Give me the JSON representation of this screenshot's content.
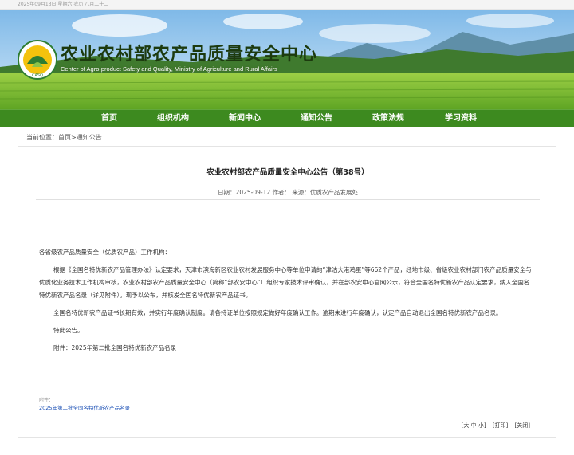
{
  "topbar": {
    "date_text": "2025年09月13日 星期六 农历 八月二十二"
  },
  "header": {
    "title": "农业农村部农产品质量安全中心",
    "subtitle": "Center of Agro-product Safety and Quality, Ministry of Agriculture and Rural Affairs",
    "colors": {
      "nav_green": "#3d8a1f",
      "field_green": "#7bbf2f",
      "sky_blue": "#8ec5ec"
    }
  },
  "nav": {
    "items": [
      "首页",
      "组织机构",
      "新闻中心",
      "通知公告",
      "政策法规",
      "学习资料"
    ]
  },
  "breadcrumb": {
    "prefix": "当前位置：",
    "home": "首页",
    "separator": ">",
    "section": "通知公告"
  },
  "article": {
    "title": "农业农村部农产品质量安全中心公告（第38号）",
    "meta": "日期：2025-09-12 作者： 来源：优质农产品发展处",
    "salutation": "各省级农产品质量安全（优质农产品）工作机构：",
    "para1": "根据《全国名特优新农产品管理办法》认定要求，天津市滨海新区农业农村发展服务中心等单位申请的“津沽大港鸡蛋”等662个产品，经地市级、省级农业农村部门农产品质量安全与优质化业务技术工作机构审核，农业农村部农产品质量安全中心（简称“部农安中心”）组织专家技术评审确认，并在部农安中心官网公示，符合全国名特优新农产品认定要求，纳入全国名特优新农产品名录（详见附件）。现予以公布，并核发全国名特优新农产品证书。",
    "para2": "全国名特优新农产品证书长期有效，并实行年度确认制度。请各持证单位按照规定做好年度确认工作。逾期未进行年度确认，认定产品自动退出全国名特优新农产品名录。",
    "para3": "特此公告。",
    "para4": "附件：2025年第二批全国名特优新农产品名录"
  },
  "attachment": {
    "label": "附件：",
    "link_text": "2025年第二批全国名特优新农产品名录"
  },
  "tools": {
    "font_size": "[大 中 小]",
    "print": "[打印]",
    "close": "[关闭]"
  }
}
